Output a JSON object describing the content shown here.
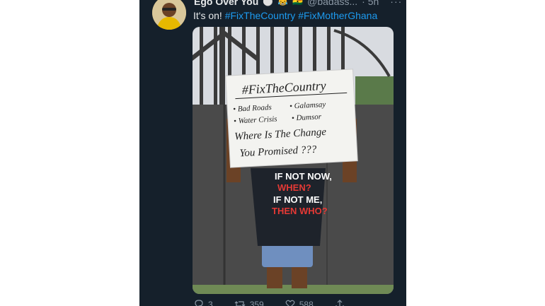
{
  "tweet": {
    "display_name": "Ego Over You",
    "name_emojis": [
      "⚪",
      "😹",
      "🇬🇭"
    ],
    "handle": "@badass...",
    "time": "· 5h",
    "more": "···",
    "text_prefix": "It's on!",
    "hashtags": [
      "#FixTheCountry",
      "#FixMotherGhana"
    ]
  },
  "sign": {
    "title": "#FixTheCountry",
    "items": [
      "• Bad Roads",
      "• Galamsay",
      "• Water Crisis",
      "• Dumsor"
    ],
    "question_line1": "Where Is The Change",
    "question_line2": "You Promised ???"
  },
  "shirt": {
    "lines": [
      "IF NOT NOW,",
      "WHEN?",
      "IF NOT ME,",
      "THEN WHO?"
    ]
  },
  "actions": {
    "reply_count": "3",
    "retweet_count": "359",
    "like_count": "588"
  }
}
